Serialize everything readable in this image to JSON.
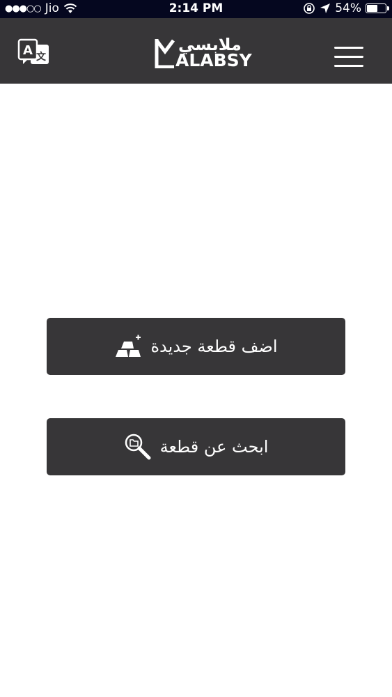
{
  "status_bar": {
    "signal_dots": "●●●○○",
    "carrier": "Jio",
    "time": "2:14 PM",
    "battery_percent": "54%",
    "battery_level": 0.54
  },
  "header": {
    "logo_arabic": "ملابسي",
    "logo_latin": "ALABSY",
    "translate_icon": "translate-icon",
    "menu_icon": "hamburger-menu-icon"
  },
  "main": {
    "add_item_label": "اضف قطعة جديدة",
    "add_item_icon": "add-item-icon",
    "search_item_label": "ابحث عن قطعة",
    "search_item_icon": "search-icon"
  },
  "colors": {
    "status_bar_bg": "#05071f",
    "header_bg": "#373638",
    "button_bg": "#373638",
    "page_bg": "#ffffff"
  }
}
